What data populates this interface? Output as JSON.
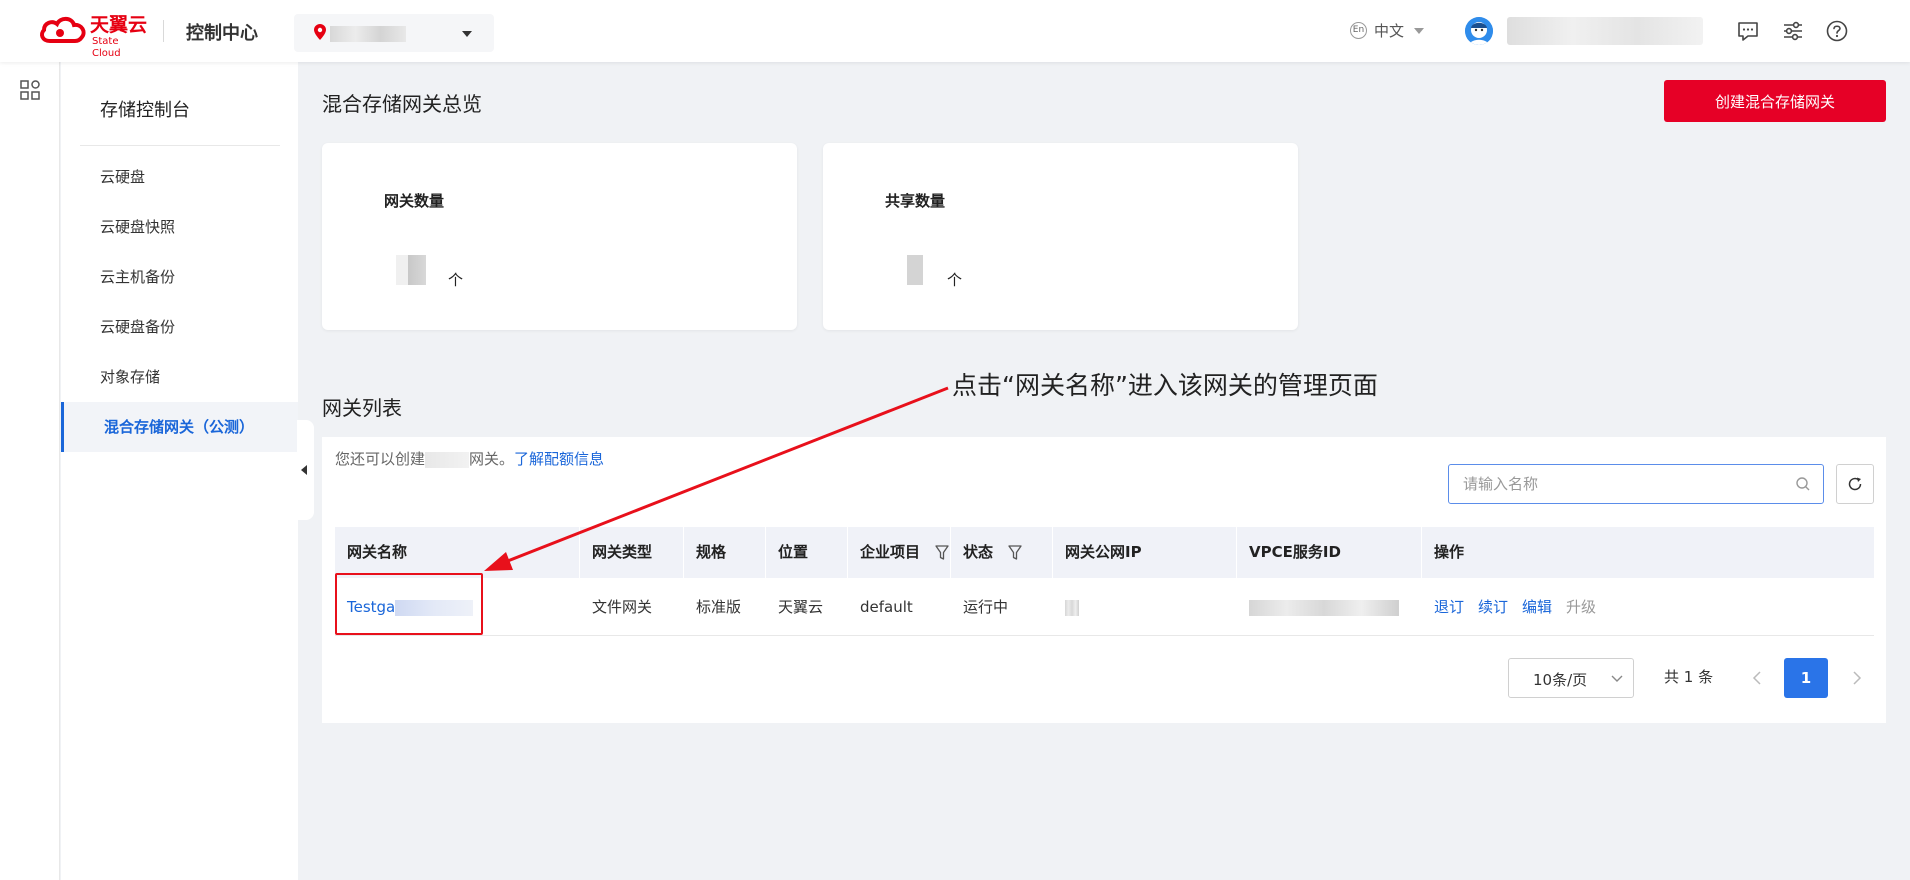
{
  "brand": {
    "name_cn": "天翼云",
    "name_en": "State Cloud",
    "console_title": "控制中心",
    "accent_color": "#e60012"
  },
  "topbar": {
    "language": "中文",
    "language_badge": "En",
    "icons": [
      "message-icon",
      "settings-sliders-icon",
      "help-icon"
    ]
  },
  "sidebar": {
    "title": "存储控制台",
    "items": [
      {
        "label": "云硬盘",
        "active": false
      },
      {
        "label": "云硬盘快照",
        "active": false
      },
      {
        "label": "云主机备份",
        "active": false
      },
      {
        "label": "云硬盘备份",
        "active": false
      },
      {
        "label": "对象存储",
        "active": false
      },
      {
        "label": "混合存储网关（公测）",
        "active": true
      }
    ]
  },
  "overview": {
    "title": "混合存储网关总览",
    "create_button": "创建混合存储网关",
    "cards": [
      {
        "label": "网关数量",
        "unit": "个"
      },
      {
        "label": "共享数量",
        "unit": "个"
      }
    ]
  },
  "annotation": {
    "text": "点击“网关名称”进入该网关的管理页面",
    "color": "#e8101b"
  },
  "gateway_list": {
    "title": "网关列表",
    "quota_note_prefix": "您还可以创建",
    "quota_note_suffix": "网关。",
    "quota_link": "了解配额信息",
    "search_placeholder": "请输入名称",
    "columns": [
      "网关名称",
      "网关类型",
      "规格",
      "位置",
      "企业项目",
      "状态",
      "网关公网IP",
      "VPCE服务ID",
      "操作"
    ],
    "rows": [
      {
        "name": "Testga",
        "type": "文件网关",
        "spec": "标准版",
        "location": "天翼云",
        "project": "default",
        "status": "运行中",
        "actions": [
          "退订",
          "续订",
          "编辑",
          "升级"
        ]
      }
    ],
    "pagination": {
      "page_size": "10条/页",
      "total": "共 1 条",
      "current_page": "1"
    }
  }
}
